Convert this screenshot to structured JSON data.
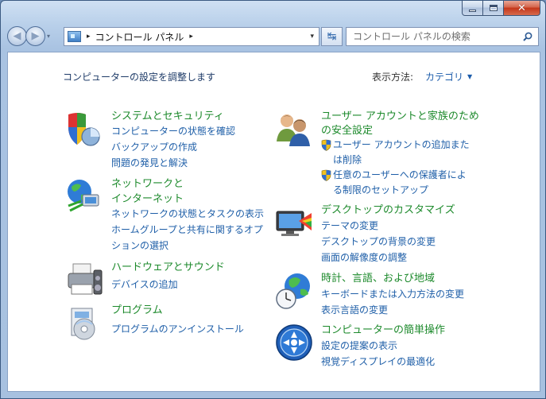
{
  "window": {
    "minimize_label": "",
    "maximize_label": "",
    "close_label": "✕"
  },
  "nav": {
    "back": "◀",
    "forward": "▶",
    "dropdown": "▾"
  },
  "address": {
    "path_separator": "▸",
    "path": "コントロール パネル",
    "trailing_separator": "▸",
    "dropdown": "▾"
  },
  "refresh": {
    "glyph": "↹"
  },
  "search": {
    "placeholder": "コントロール パネルの検索"
  },
  "header": {
    "subtitle": "コンピューターの設定を調整します",
    "view_by_label": "表示方法:",
    "view_by_value": "カテゴリ",
    "view_by_caret": "▼"
  },
  "categories": {
    "system": {
      "icon": "shield-pie-icon",
      "title": "システムとセキュリティ",
      "links": [
        "コンピューターの状態を確認",
        "バックアップの作成",
        "問題の発見と解決"
      ]
    },
    "network": {
      "icon": "globe-network-icon",
      "title_line1": "ネットワークと",
      "title_line2": "インターネット",
      "links": [
        "ネットワークの状態とタスクの表示",
        "ホームグループと共有に関するオプ",
        "ションの選択"
      ]
    },
    "hardware": {
      "icon": "printer-icon",
      "title": "ハードウェアとサウンド",
      "links": [
        "デバイスの追加"
      ]
    },
    "programs": {
      "icon": "program-disc-icon",
      "title": "プログラム",
      "links": [
        "プログラムのアンインストール"
      ]
    },
    "users": {
      "icon": "users-icon",
      "title_line1": "ユーザー アカウントと家族のため",
      "title_line2": "の安全設定",
      "links": [
        "ユーザー アカウントの追加また",
        "は削除",
        "任意のユーザーへの保護者によ",
        "る制限のセットアップ"
      ]
    },
    "appearance": {
      "icon": "monitor-palette-icon",
      "title": "デスクトップのカスタマイズ",
      "links": [
        "テーマの変更",
        "デスクトップの背景の変更",
        "画面の解像度の調整"
      ]
    },
    "clock": {
      "icon": "clock-globe-icon",
      "title": "時計、言語、および地域",
      "links": [
        "キーボードまたは入力方法の変更",
        "表示言語の変更"
      ]
    },
    "access": {
      "icon": "ease-of-access-icon",
      "title": "コンピューターの簡単操作",
      "links": [
        "設定の提案の表示",
        "視覚ディスプレイの最適化"
      ]
    }
  }
}
